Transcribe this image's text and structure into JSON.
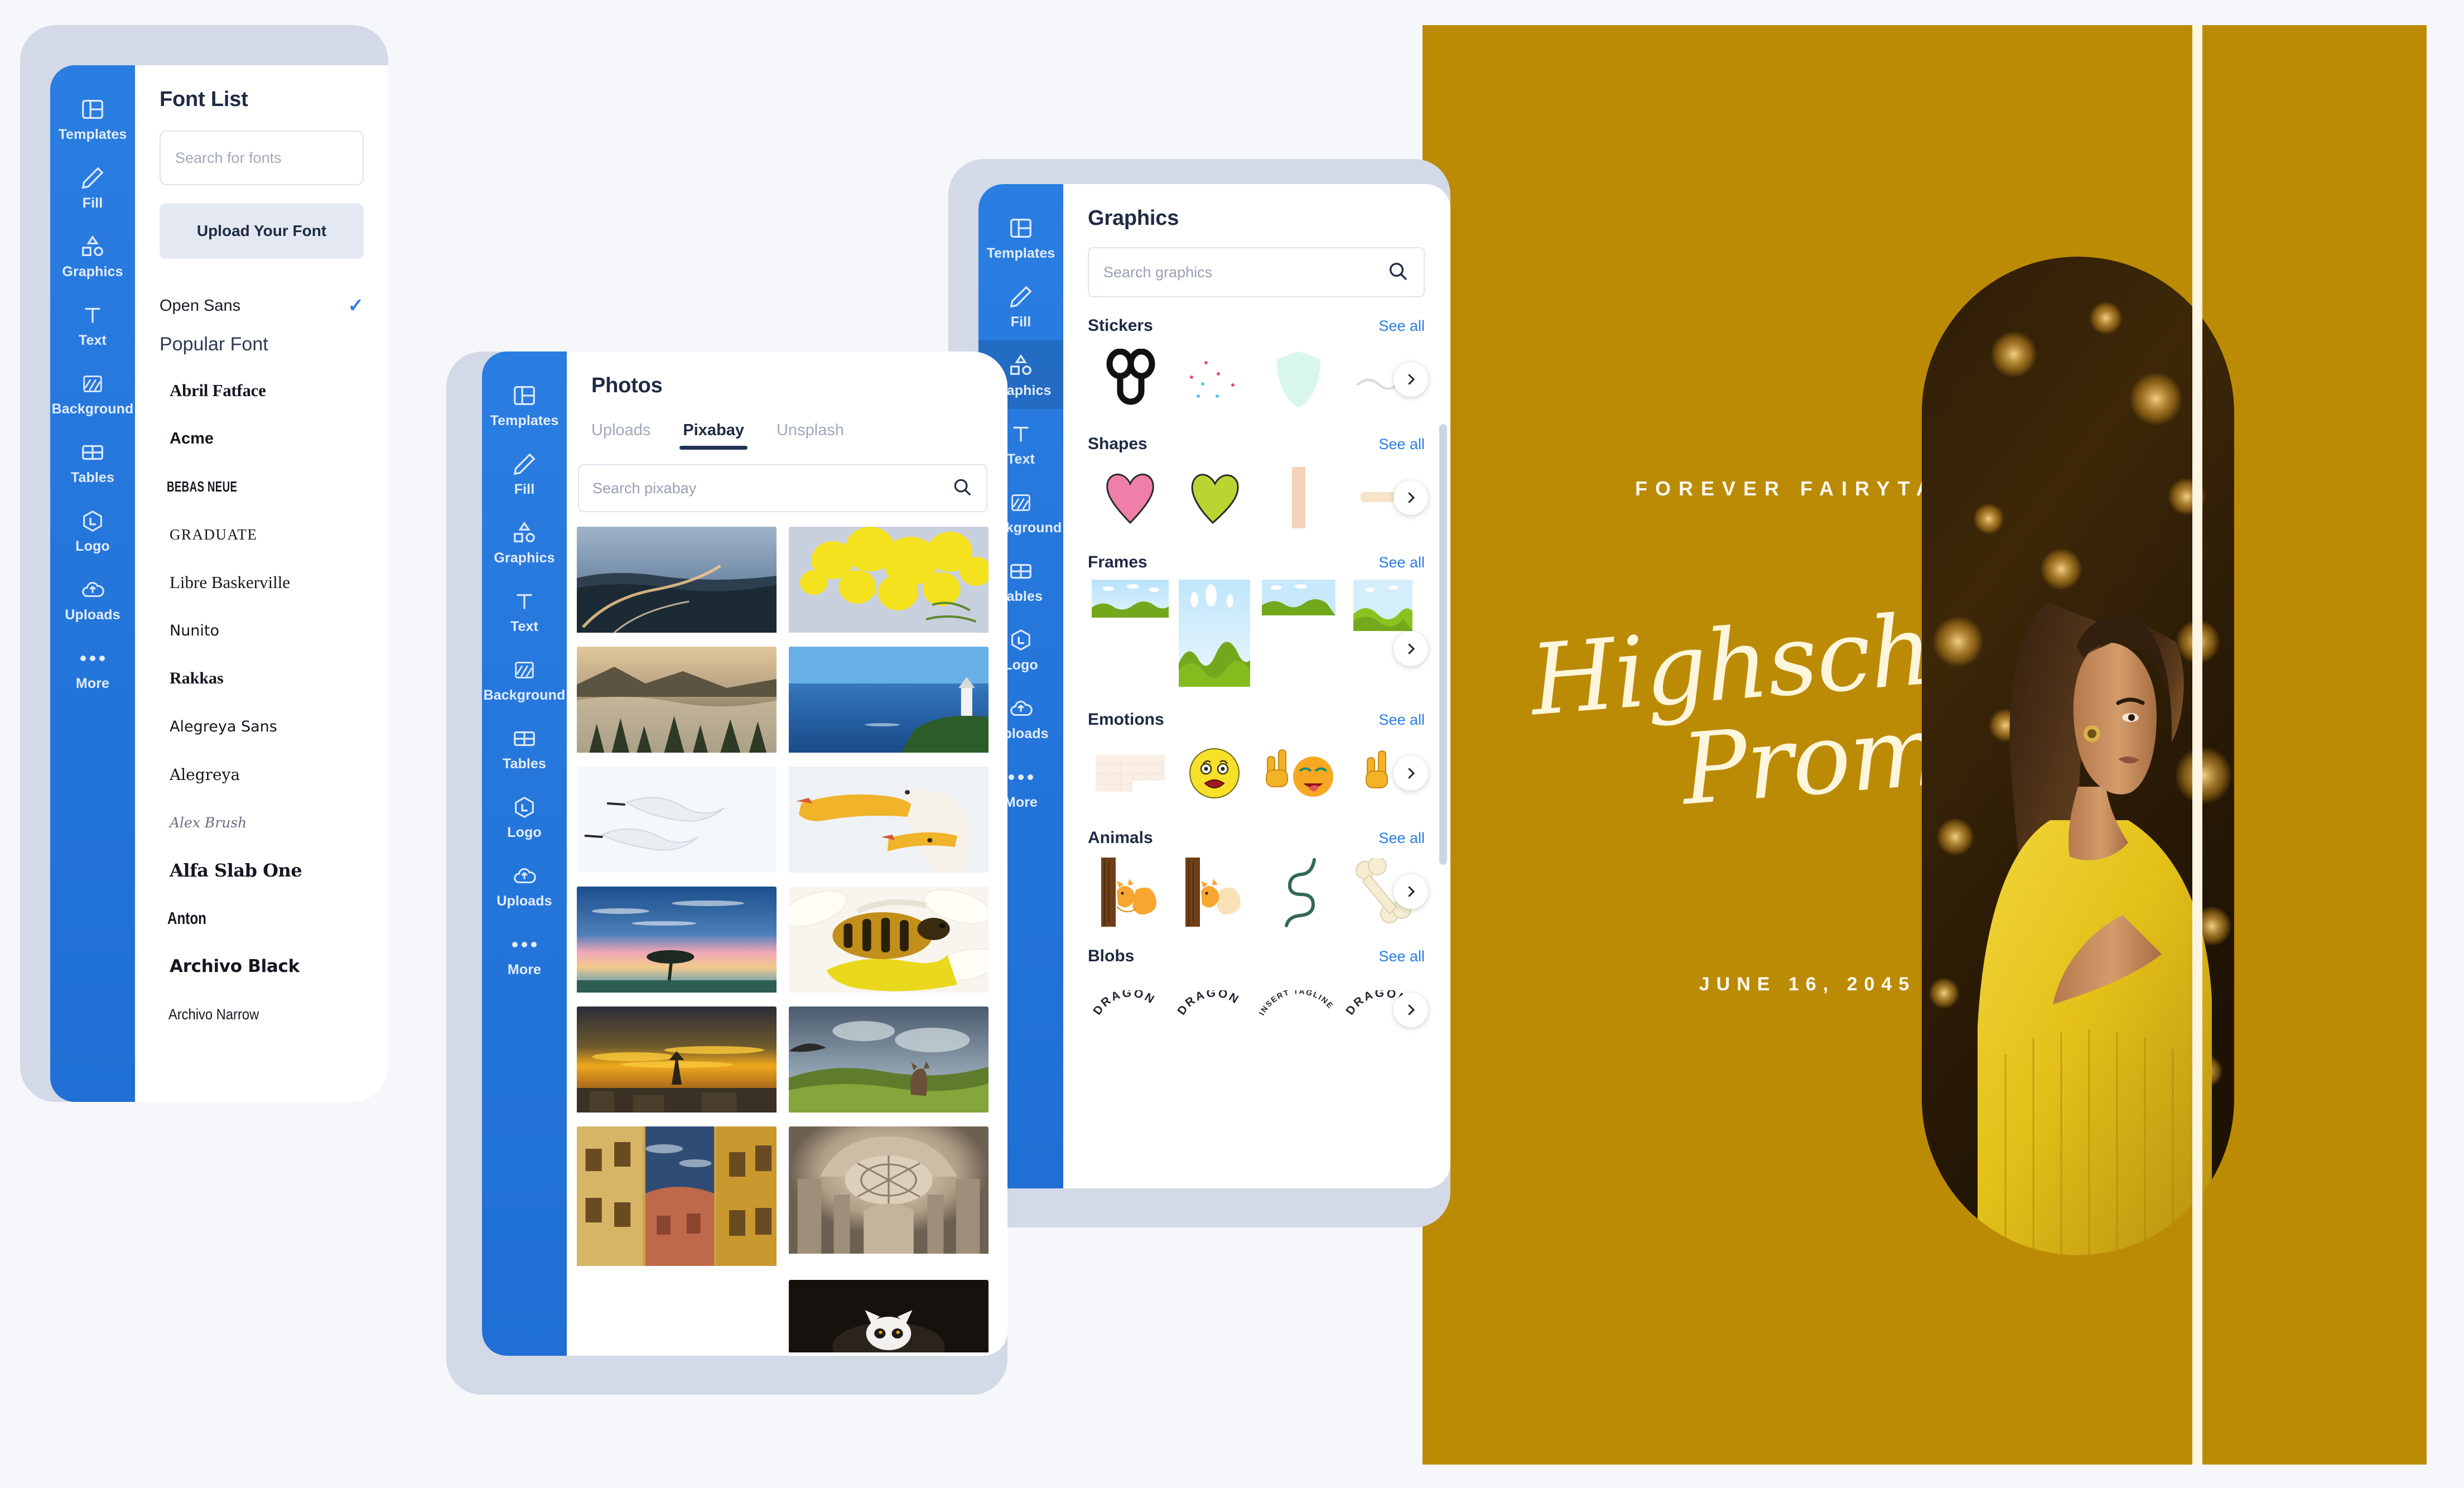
{
  "theme": {
    "rail_blue": "#1f6fd4",
    "panel_border": "#d3d9e6",
    "page_bg": "#f5f7fb",
    "accent_link": "#2a7de1",
    "poster_gold": "#bc8b05",
    "poster_cream": "#fdf6dd"
  },
  "rail": {
    "items": [
      {
        "label": "Templates",
        "icon": "templates-icon"
      },
      {
        "label": "Fill",
        "icon": "pencil-icon"
      },
      {
        "label": "Graphics",
        "icon": "shapes-icon"
      },
      {
        "label": "Text",
        "icon": "text-icon"
      },
      {
        "label": "Background",
        "icon": "background-icon"
      },
      {
        "label": "Tables",
        "icon": "tables-icon"
      },
      {
        "label": "Logo",
        "icon": "logo-icon"
      },
      {
        "label": "Uploads",
        "icon": "upload-cloud-icon"
      },
      {
        "label": "More",
        "icon": "ellipsis-icon"
      }
    ]
  },
  "font_panel": {
    "title": "Font List",
    "search_placeholder": "Search for fonts",
    "upload_label": "Upload Your Font",
    "selected_font": "Open Sans",
    "selected_check": "✓",
    "section_label": "Popular Font",
    "fonts": [
      {
        "name": "Abril Fatface",
        "style": "f-abril"
      },
      {
        "name": "Acme",
        "style": "f-acme"
      },
      {
        "name": "BEBAS NEUE",
        "style": "f-bebas"
      },
      {
        "name": "GRADUATE",
        "style": "f-graduate"
      },
      {
        "name": "Libre Baskerville",
        "style": "f-libre"
      },
      {
        "name": "Nunito",
        "style": "f-nunito"
      },
      {
        "name": "Rakkas",
        "style": "f-rakkas"
      },
      {
        "name": "Alegreya Sans",
        "style": "f-alegsans"
      },
      {
        "name": "Alegreya",
        "style": "f-alegreya"
      },
      {
        "name": "Alex Brush",
        "style": "f-alexbrush"
      },
      {
        "name": "Alfa Slab One",
        "style": "f-alfaslab"
      },
      {
        "name": "Anton",
        "style": "f-anton"
      },
      {
        "name": "Archivo Black",
        "style": "f-archblack"
      },
      {
        "name": "Archivo Narrow",
        "style": "f-archnarrow"
      }
    ]
  },
  "photos_panel": {
    "title": "Photos",
    "tabs": [
      {
        "label": "Uploads",
        "active": false
      },
      {
        "label": "Pixabay",
        "active": true
      },
      {
        "label": "Unsplash",
        "active": false
      }
    ],
    "search_placeholder": "Search pixabay",
    "results": [
      {
        "alt": "coastal-bridge-at-dusk",
        "ratio": 0.62
      },
      {
        "alt": "yellow-mimosa-blossoms",
        "ratio": 0.62
      },
      {
        "alt": "misty-forest-mountains",
        "ratio": 0.62
      },
      {
        "alt": "lighthouse-over-blue-sea",
        "ratio": 0.62
      },
      {
        "alt": "two-white-birds-flying",
        "ratio": 0.62
      },
      {
        "alt": "two-pelicans-close-up",
        "ratio": 0.62
      },
      {
        "alt": "lone-tree-at-sunset",
        "ratio": 0.62
      },
      {
        "alt": "honeybee-on-flower",
        "ratio": 0.62
      },
      {
        "alt": "golden-sunset-over-pagoda-city",
        "ratio": 0.62
      },
      {
        "alt": "kangaroo-on-hillside",
        "ratio": 0.62
      },
      {
        "alt": "narrow-old-town-street",
        "ratio": 0.8
      },
      {
        "alt": "baroque-cathedral-ceiling",
        "ratio": 0.72
      },
      {
        "alt": "lemur-in-the-dark",
        "ratio": 0.4
      }
    ]
  },
  "graphics_panel": {
    "title": "Graphics",
    "search_placeholder": "Search graphics",
    "see_all_label": "See all",
    "sections": [
      {
        "title": "Stickers",
        "items": [
          "black-glasses-sticker",
          "confetti-dots-sticker",
          "mint-shield-sticker",
          "squiggle-sticker"
        ]
      },
      {
        "title": "Shapes",
        "items": [
          "pink-heart-shape",
          "green-heart-shape",
          "peach-bar-shape",
          "peach-rounded-bar-shape"
        ]
      },
      {
        "title": "Frames",
        "items": [
          "landscape-frame-wide",
          "landscape-frame-tall",
          "landscape-frame-wide-2",
          "landscape-frame-small"
        ]
      },
      {
        "title": "Emotions",
        "items": [
          "blank-grid-emotion",
          "shocked-face-emoji",
          "rock-on-tongue-emoji",
          "rock-hand-emoji"
        ]
      },
      {
        "title": "Animals",
        "items": [
          "squirrel-on-tree",
          "squirrel-on-tree-2",
          "green-snake",
          "dog-bone"
        ]
      },
      {
        "title": "Blobs",
        "items": [
          "DRAGON",
          "DRAGON",
          "INSERT TAGLINE",
          "DR"
        ]
      }
    ]
  },
  "design_canvas": {
    "kicker": "FOREVER FAIRYTALE",
    "title_line1": "Highschool",
    "title_line2": "Prom",
    "date": "JUNE 16, 2045",
    "photo_alt": "woman-in-yellow-dress-with-bokeh-lights"
  }
}
